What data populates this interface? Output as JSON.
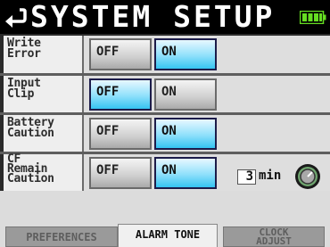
{
  "header": {
    "title": "SYSTEM SETUP"
  },
  "rows": [
    {
      "label": "Write\nError",
      "options": [
        "OFF",
        "ON"
      ],
      "selected": "ON"
    },
    {
      "label": "Input\nClip",
      "options": [
        "OFF",
        "ON"
      ],
      "selected": "OFF"
    },
    {
      "label": "Battery\nCaution",
      "options": [
        "OFF",
        "ON"
      ],
      "selected": "ON"
    },
    {
      "label": "CF\nRemain\nCaution",
      "options": [
        "OFF",
        "ON"
      ],
      "selected": "ON",
      "time_value": "3",
      "time_unit": "min"
    }
  ],
  "tabs": [
    {
      "label": "PREFERENCES",
      "active": false
    },
    {
      "label": "ALARM TONE",
      "active": true
    },
    {
      "label": "CLOCK\nADJUST",
      "active": false
    }
  ],
  "colors": {
    "selected": "#35c4f2",
    "unselected": "#cfcfcf",
    "header_bg": "#000000",
    "battery": "#66dd22"
  },
  "icons": {
    "back": "return-arrow-icon",
    "battery": "battery-icon",
    "knob": "knob-icon"
  }
}
